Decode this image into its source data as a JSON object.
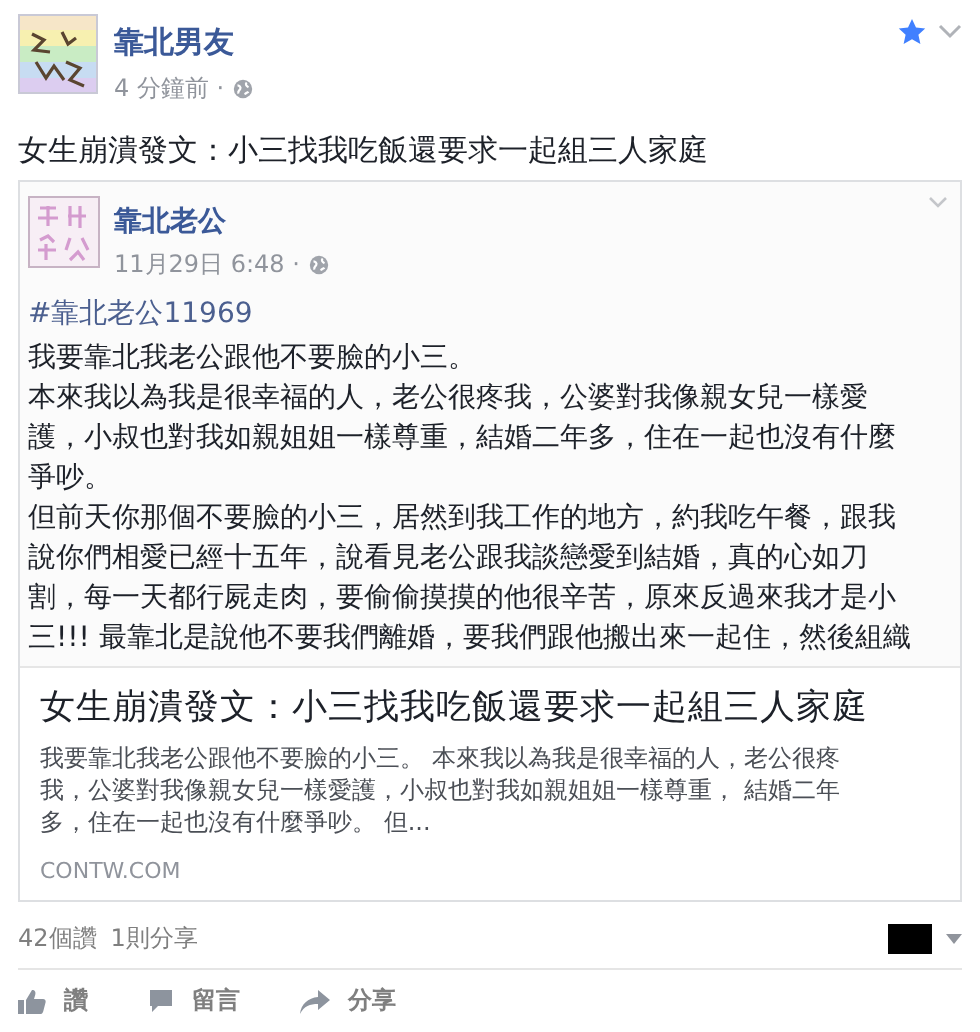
{
  "post": {
    "author": "靠北男友",
    "time": "4 分鐘前 ·",
    "message": "女生崩潰發文：小三找我吃飯還要求一起組三人家庭"
  },
  "shared": {
    "image": {
      "author": "靠北老公",
      "time": "11月29日 6:48 ·",
      "hashtag": "#靠北老公11969",
      "lines": [
        "我要靠北我老公跟他不要臉的小三。",
        "本來我以為我是很幸福的人，老公很疼我，公婆對我像親女兒一樣愛",
        "護，小叔也對我如親姐姐一樣尊重，結婚二年多，住在一起也沒有什麼",
        "爭吵。",
        "但前天你那個不要臉的小三，居然到我工作的地方，約我吃午餐，跟我",
        "說你們相愛已經十五年，說看見老公跟我談戀愛到結婚，真的心如刀",
        "割，每一天都行屍走肉，要偷偷摸摸的他很辛苦，原來反過來我才是小",
        "三!!! 最靠北是說他不要我們離婚，要我們跟他搬出來一起住，然後組織"
      ]
    },
    "title": "女生崩潰發文：小三找我吃飯還要求一起組三人家庭",
    "description": [
      "我要靠北我老公跟他不要臉的小三。 本來我以為我是很幸福的人，老公很疼",
      "我，公婆對我像親女兒一樣愛護，小叔也對我如親姐姐一樣尊重， 結婚二年",
      "多，住在一起也沒有什麼爭吵。 但..."
    ],
    "domain": "CONTW.COM"
  },
  "stats": {
    "likes": "42個讚",
    "shares": "1則分享"
  },
  "actions": [
    {
      "kind": "like",
      "label": "讚"
    },
    {
      "kind": "comment",
      "label": "留言"
    },
    {
      "kind": "share",
      "label": "分享"
    }
  ]
}
